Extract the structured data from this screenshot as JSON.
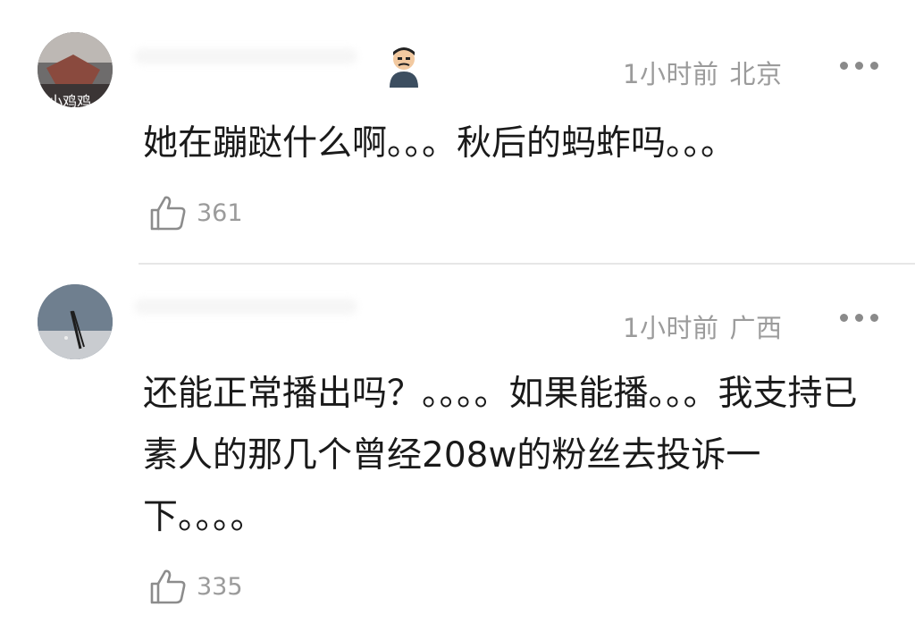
{
  "comments": [
    {
      "avatar_text": "小鸡鸡",
      "time": "1小时前",
      "location": "北京",
      "text": "她在蹦跶什么啊。。。秋后的蚂蚱吗。。。",
      "likes": "361",
      "icons": {
        "badge": "emoji-badge-icon",
        "more": "more-dots-icon",
        "like": "thumb-up-icon"
      }
    },
    {
      "time": "1小时前",
      "location": "广西",
      "text": "还能正常播出吗？。。。。如果能播。。。我支持已素人的那几个曾经208w的粉丝去投诉一下。。。。",
      "likes": "335",
      "icons": {
        "more": "more-dots-icon",
        "like": "thumb-up-icon"
      }
    }
  ]
}
